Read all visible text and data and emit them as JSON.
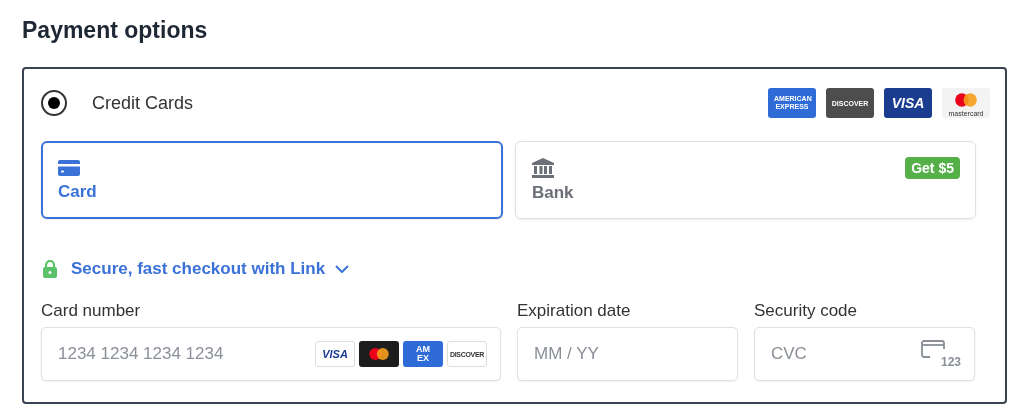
{
  "title": "Payment options",
  "method": {
    "label": "Credit Cards",
    "selected": true,
    "brands": [
      {
        "kind": "amex",
        "label": "AMERICAN EXPRESS"
      },
      {
        "kind": "discover",
        "label": "DISCOVER"
      },
      {
        "kind": "visa",
        "label": "VISA"
      },
      {
        "kind": "mastercard",
        "label": "mastercard"
      }
    ]
  },
  "tabs": [
    {
      "kind": "card",
      "label": "Card",
      "selected": true
    },
    {
      "kind": "bank",
      "label": "Bank",
      "selected": false,
      "badge": "Get $5"
    }
  ],
  "link": {
    "label": "Secure, fast checkout with Link",
    "expanded": false
  },
  "fields": [
    {
      "kind": "number",
      "label": "Card number",
      "placeholder": "1234 1234 1234 1234",
      "brands": [
        {
          "kind": "visa",
          "label": "VISA"
        },
        {
          "kind": "mastercard"
        },
        {
          "kind": "amex",
          "label": "AM EX"
        },
        {
          "kind": "discover",
          "label": "DISCOVER"
        }
      ]
    },
    {
      "kind": "expiry",
      "label": "Expiration date",
      "placeholder": "MM / YY"
    },
    {
      "kind": "cvc",
      "label": "Security code",
      "placeholder": "CVC",
      "icon_text": "123"
    }
  ]
}
